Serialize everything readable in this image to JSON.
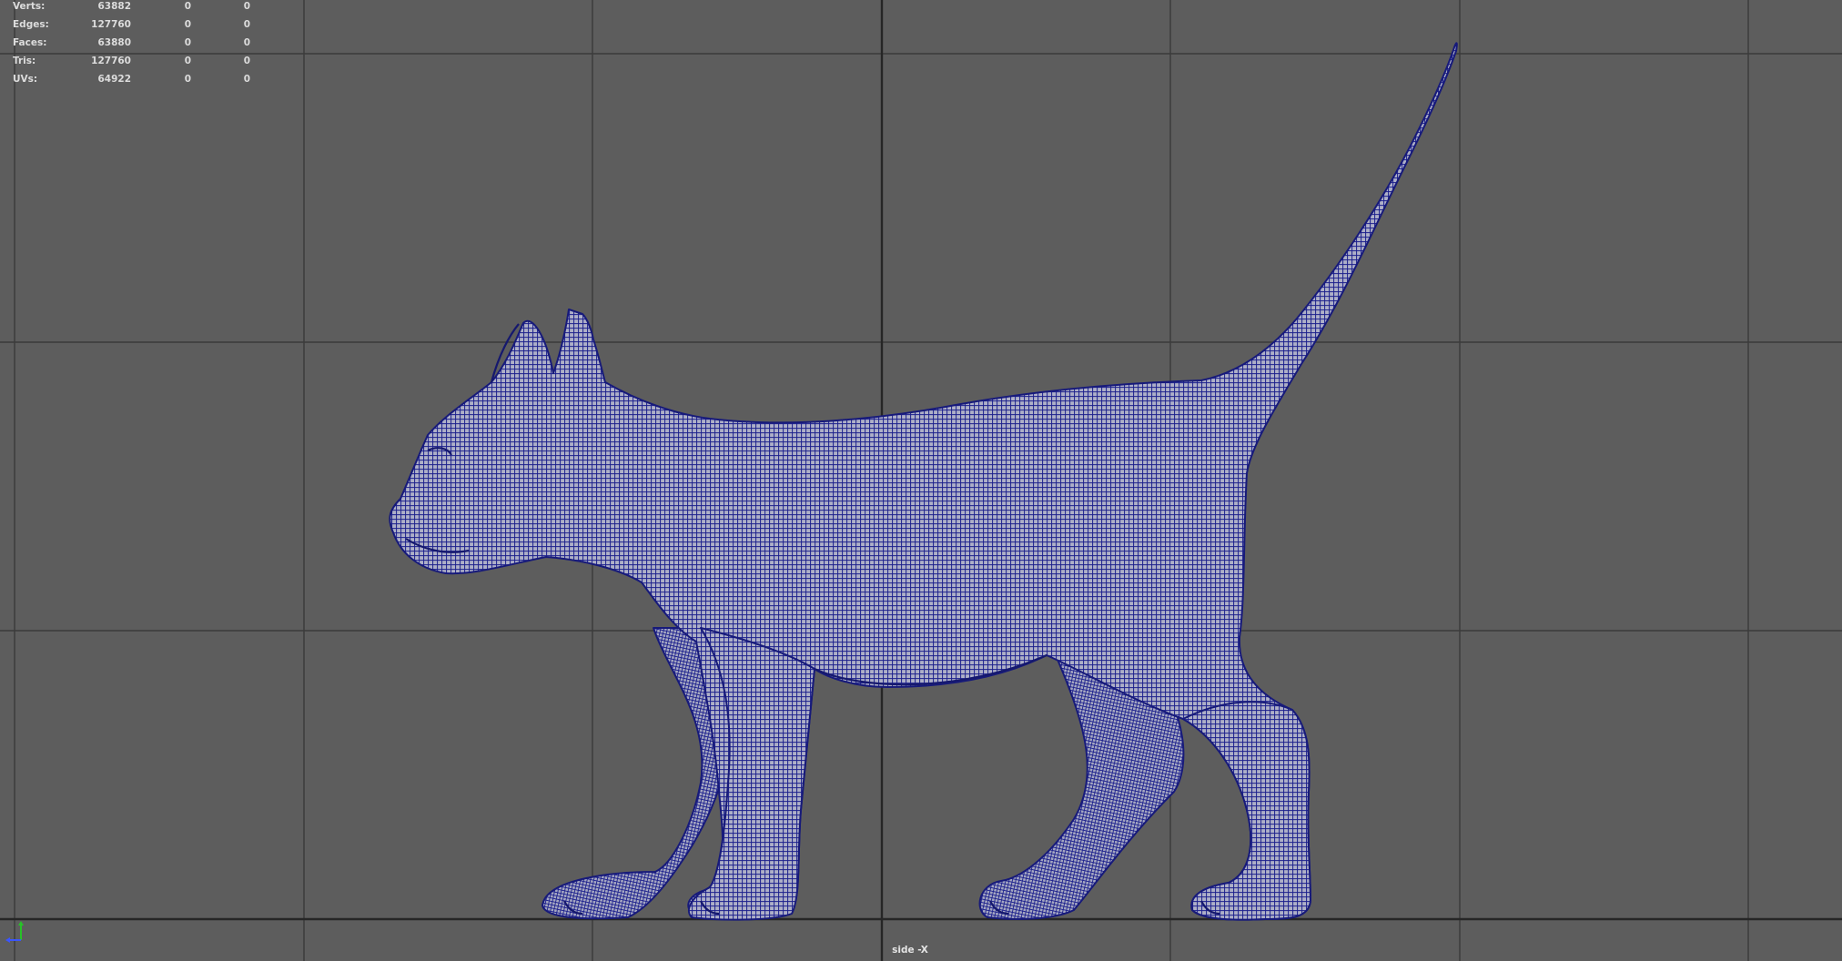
{
  "viewport": {
    "camera_label": "side -X",
    "background_color": "#5d5d5d",
    "grid_color": "#3b3b3b",
    "wire_color": "#1b1f8c",
    "mesh_fill_color": "#aeb0c8",
    "object_description": "cat"
  },
  "hud": {
    "rows": [
      {
        "label": "Verts:",
        "v1": "63882",
        "v2": "0",
        "v3": "0"
      },
      {
        "label": "Edges:",
        "v1": "127760",
        "v2": "0",
        "v3": "0"
      },
      {
        "label": "Faces:",
        "v1": "63880",
        "v2": "0",
        "v3": "0"
      },
      {
        "label": "Tris:",
        "v1": "127760",
        "v2": "0",
        "v3": "0"
      },
      {
        "label": "UVs:",
        "v1": "64922",
        "v2": "0",
        "v3": "0"
      }
    ]
  },
  "axis_gizmo": {
    "y_color": "#28c228",
    "z_color": "#3a55ff"
  }
}
